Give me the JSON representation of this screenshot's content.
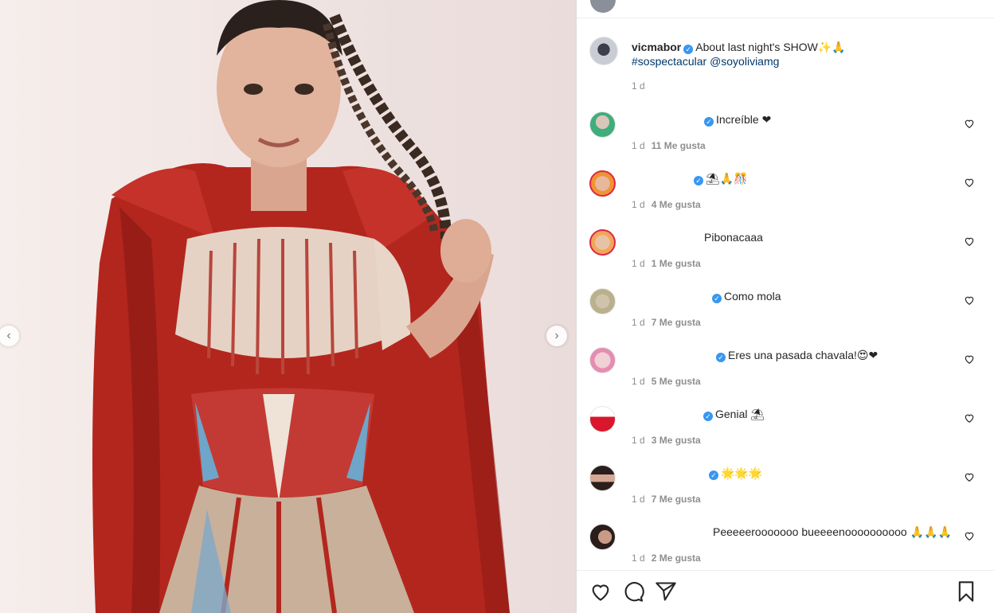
{
  "post": {
    "username": "vicmabor",
    "caption": "About last night's SHOW✨🙏",
    "hashtag": "#sospectacular",
    "mention": "@soyoliviamg",
    "time": "1 d"
  },
  "comments": [
    {
      "text": "Increíble ❤",
      "time": "1 d",
      "likes": "11 Me gusta",
      "verified": true
    },
    {
      "text": "⛱🙏🎊",
      "time": "1 d",
      "likes": "4 Me gusta",
      "verified": true
    },
    {
      "text": "Pibonacaaa",
      "time": "1 d",
      "likes": "1 Me gusta",
      "verified": false
    },
    {
      "text": "Como mola",
      "time": "1 d",
      "likes": "7 Me gusta",
      "verified": true
    },
    {
      "text": "Eres una pasada chavala!😍❤",
      "time": "1 d",
      "likes": "5 Me gusta",
      "verified": true
    },
    {
      "text": "Genial ⛱",
      "time": "1 d",
      "likes": "3 Me gusta",
      "verified": true
    },
    {
      "text": "🌟🌟🌟",
      "time": "1 d",
      "likes": "7 Me gusta",
      "verified": true
    },
    {
      "text": "Peeeeerooooooo bueeeenoooooooooo 🙏🙏🙏",
      "time": "1 d",
      "likes": "2 Me gusta",
      "verified": false
    }
  ],
  "icons": {
    "like": "heart-icon",
    "comment": "comment-icon",
    "share": "paper-plane-icon",
    "save": "bookmark-icon",
    "prev": "chevron-left-icon",
    "next": "chevron-right-icon"
  },
  "colors": {
    "verified": "#3897f0",
    "link": "#00376b",
    "meta": "#8e8e8e",
    "cape": "#b3261e"
  }
}
